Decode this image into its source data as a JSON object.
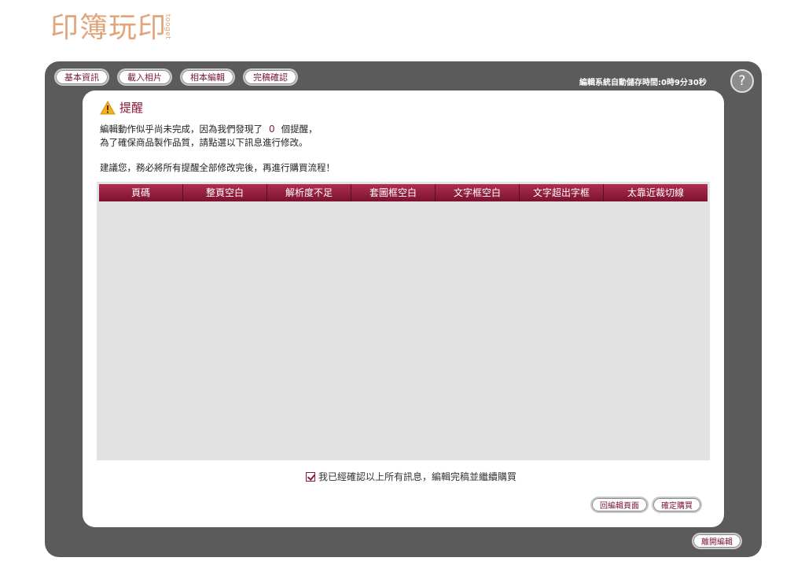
{
  "logo": {
    "text": "印簿玩印",
    "sub": "tooget"
  },
  "nav": {
    "items": [
      {
        "label": "基本資訊"
      },
      {
        "label": "載入相片"
      },
      {
        "label": "相本編輯"
      },
      {
        "label": "完稿確認"
      }
    ]
  },
  "autosave": "編輯系統自動儲存時間:0時9分30秒",
  "help_label": "?",
  "alert": {
    "title": "提醒",
    "line1_prefix": "編輯動作似乎尚未完成，因為我們發現了",
    "count": "0",
    "line1_suffix": "個提醒，",
    "line2": "為了確保商品製作品質，請點選以下訊息進行修改。",
    "line3": "建議您，務必將所有提醒全部修改完後，再進行購買流程！"
  },
  "table": {
    "columns": [
      "頁碼",
      "整頁空白",
      "解析度不足",
      "套圖框空白",
      "文字框空白",
      "文字超出字框",
      "太靠近裁切線"
    ],
    "rows": []
  },
  "confirm_label": "我已經確認以上所有訊息，編輯完稿並繼續購買",
  "buttons": {
    "back": "回編輯頁面",
    "buy": "確定購買",
    "leave": "離開編輯"
  },
  "colors": {
    "frame": "#5b5b5b",
    "accent": "#8a1a3a",
    "header": "#9a2343",
    "logo": "#e0a57a"
  }
}
